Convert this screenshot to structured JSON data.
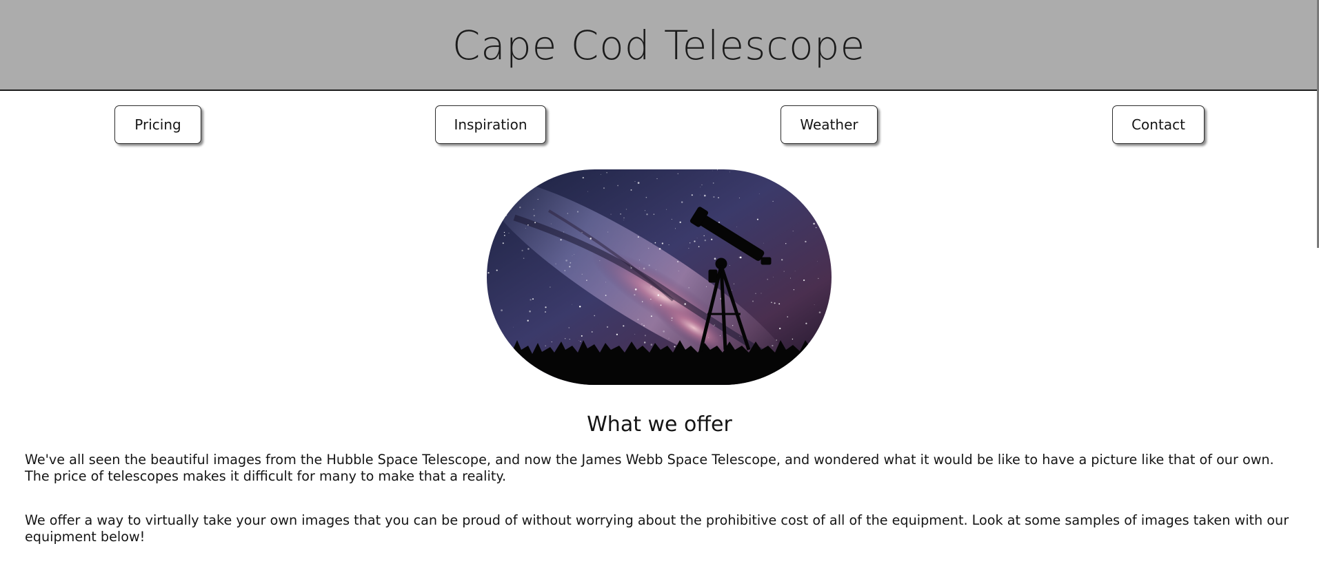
{
  "header": {
    "title": "Cape Cod Telescope"
  },
  "nav": {
    "items": [
      {
        "label": "Pricing"
      },
      {
        "label": "Inspiration"
      },
      {
        "label": "Weather"
      },
      {
        "label": "Contact"
      }
    ]
  },
  "hero": {
    "image_alt": "milky-way-telescope-silhouette"
  },
  "main": {
    "heading": "What we offer",
    "paragraphs": [
      "We've all seen the beautiful images from the Hubble Space Telescope, and now the James Webb Space Telescope, and wondered what it would be like to have a picture like that of our own. The price of telescopes makes it difficult for many to make that a reality.",
      "We offer a way to virtually take your own images that you can be proud of without worrying about the prohibitive cost of all of the equipment. Look at some samples of images taken with our equipment below!"
    ]
  },
  "colors": {
    "header_bg": "#acacac",
    "page_bg": "#ffffff",
    "text": "#151515"
  }
}
